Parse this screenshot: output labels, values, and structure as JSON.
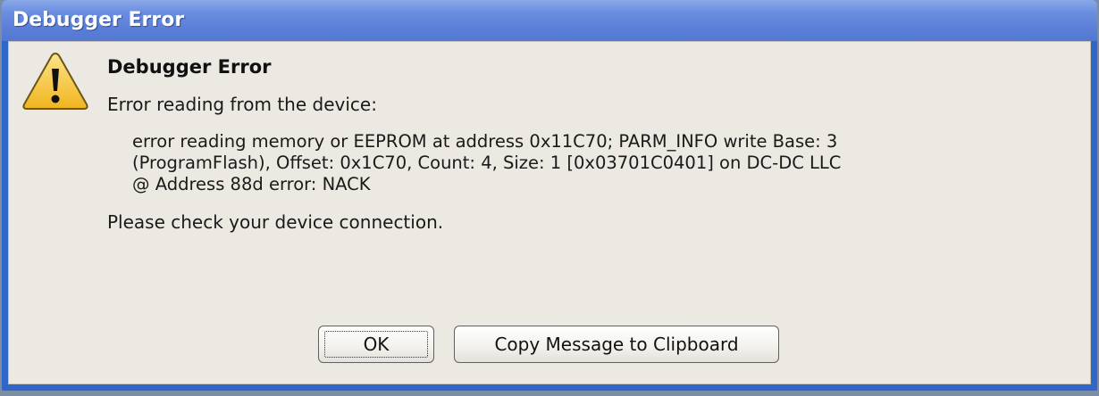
{
  "window": {
    "title": "Debugger Error"
  },
  "dialog": {
    "heading": "Debugger Error",
    "intro": "Error reading from the device:",
    "detail_lines": [
      "error reading memory or EEPROM at address 0x11C70; PARM_INFO write Base: 3",
      "(ProgramFlash), Offset: 0x1C70, Count: 4, Size: 1 [0x03701C0401] on DC-DC LLC",
      "@ Address 88d error: NACK"
    ],
    "prompt": "Please check your device connection.",
    "icon": "warning-icon"
  },
  "buttons": {
    "ok_label": "OK",
    "copy_label": "Copy Message to Clipboard"
  },
  "colors": {
    "titlebar": "#5b7fd8",
    "frame": "#2f66c8",
    "client_bg": "#ece8e2",
    "warning_fill": "#f5c531"
  }
}
